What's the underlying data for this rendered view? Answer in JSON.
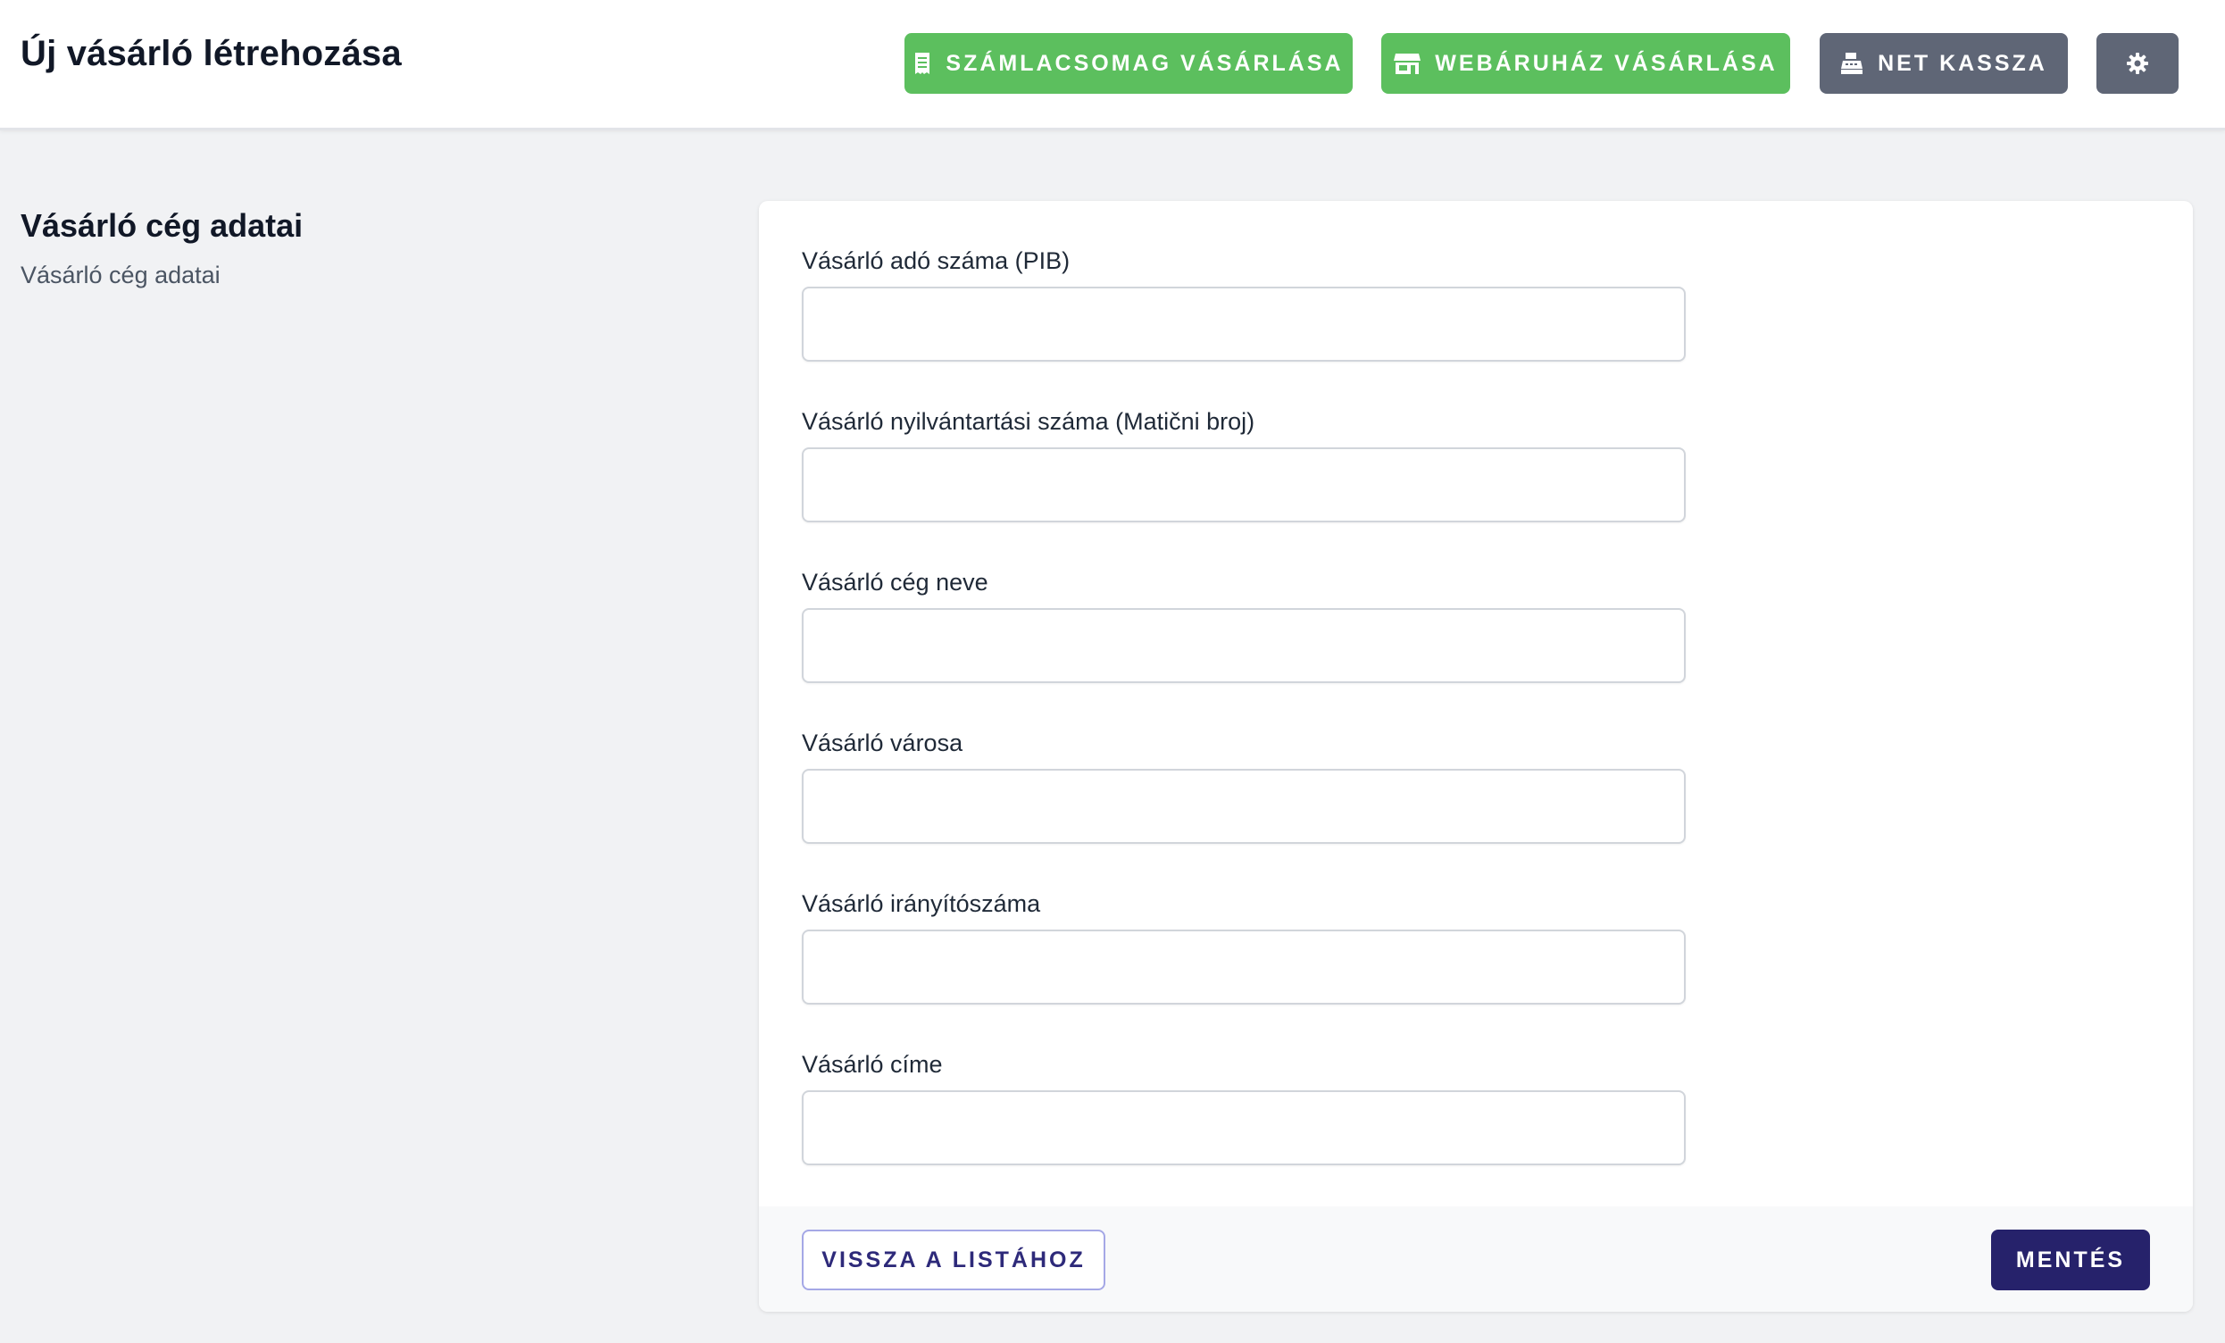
{
  "header": {
    "title": "Új vásárló létrehozása",
    "buttons": {
      "szamlacsomag": "SZÁMLACSOMAG VÁSÁRLÁSA",
      "webaruhaz": "WEBÁRUHÁZ VÁSÁRLÁSA",
      "net_kassza": "NET KASSZA"
    },
    "icons": {
      "szamlacsomag": "receipt-icon",
      "webaruhaz": "store-icon",
      "net_kassza": "cash-register-icon",
      "settings": "gear-icon"
    }
  },
  "section": {
    "title": "Vásárló cég adatai",
    "subtitle": "Vásárló cég adatai"
  },
  "form": {
    "fields": [
      {
        "label": "Vásárló adó száma (PIB)",
        "value": ""
      },
      {
        "label": "Vásárló nyilvántartási száma (Matični broj)",
        "value": ""
      },
      {
        "label": "Vásárló cég neve",
        "value": ""
      },
      {
        "label": "Vásárló városa",
        "value": ""
      },
      {
        "label": "Vásárló irányítószáma",
        "value": ""
      },
      {
        "label": "Vásárló címe",
        "value": ""
      }
    ]
  },
  "footer": {
    "back_label": "VISSZA A LISTÁHOZ",
    "save_label": "MENTÉS"
  },
  "colors": {
    "green_button": "#5cbf5e",
    "gray_button": "#5f6676",
    "primary_button": "#26226b",
    "background": "#f1f2f4"
  }
}
